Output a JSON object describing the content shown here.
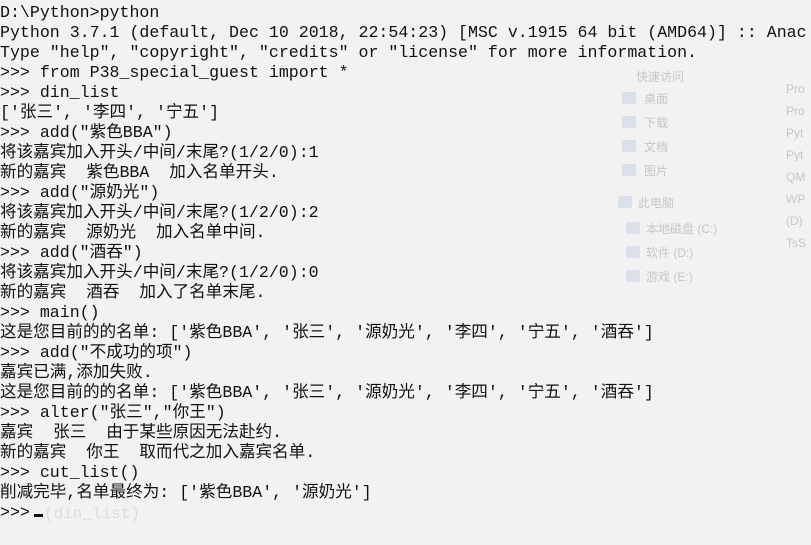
{
  "console": {
    "lines": [
      "D:\\Python>python",
      "Python 3.7.1 (default, Dec 10 2018, 22:54:23) [MSC v.1915 64 bit (AMD64)] :: Anac",
      "Type \"help\", \"copyright\", \"credits\" or \"license\" for more information.",
      ">>> from P38_special_guest import *",
      ">>> din_list",
      "['张三', '李四', '宁五']",
      ">>> add(\"紫色BBA\")",
      "将该嘉宾加入开头/中间/末尾?(1/2/0):1",
      "新的嘉宾  紫色BBA  加入名单开头.",
      ">>> add(\"源奶光\")",
      "将该嘉宾加入开头/中间/末尾?(1/2/0):2",
      "新的嘉宾  源奶光  加入名单中间.",
      ">>> add(\"酒吞\")",
      "将该嘉宾加入开头/中间/末尾?(1/2/0):0",
      "新的嘉宾  酒吞  加入了名单末尾.",
      ">>> main()",
      "这是您目前的的名单: ['紫色BBA', '张三', '源奶光', '李四', '宁五', '酒吞']",
      ">>> add(\"不成功的项\")",
      "嘉宾已满,添加失败.",
      "这是您目前的的名单: ['紫色BBA', '张三', '源奶光', '李四', '宁五', '酒吞']",
      ">>> alter(\"张三\",\"你王\")",
      "嘉宾  张三  由于某些原因无法赴约.",
      "新的嘉宾  你王  取而代之加入嘉宾名单.",
      ">>> cut_list()",
      "削减完毕,名单最终为: ['紫色BBA', '源奶光']",
      ">>>"
    ]
  },
  "background_explorer": {
    "items": [
      "快速访问",
      "桌面",
      "下载",
      "文档",
      "图片",
      "此电脑",
      "本地磁盘 (C:)",
      "软件 (D:)",
      "游戏 (E:)"
    ],
    "right_items": [
      "Pro",
      "Pro",
      "Pyt",
      "Pyt",
      "QM",
      "WP",
      "(D)",
      "TsS"
    ]
  },
  "background_code": [
    "(din_list)"
  ],
  "colors": {
    "background": "#f2f2f2",
    "text": "#111111"
  }
}
